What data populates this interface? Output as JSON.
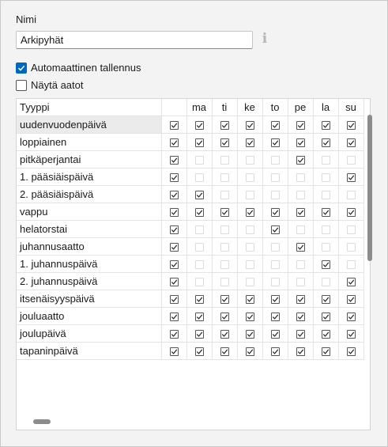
{
  "form": {
    "name_label": "Nimi",
    "name_value": "Arkipyhät",
    "info_icon": "i",
    "auto_save_label": "Automaattinen tallennus",
    "auto_save_checked": true,
    "show_eves_label": "Näytä aatot",
    "show_eves_checked": false
  },
  "grid": {
    "type_header": "Tyyppi",
    "day_headers": [
      "",
      "ma",
      "ti",
      "ke",
      "to",
      "pe",
      "la",
      "su"
    ],
    "rows": [
      {
        "name": "uudenvuodenpäivä",
        "checks": [
          1,
          1,
          1,
          1,
          1,
          1,
          1,
          1
        ],
        "selected": true
      },
      {
        "name": "loppiainen",
        "checks": [
          1,
          1,
          1,
          1,
          1,
          1,
          1,
          1
        ]
      },
      {
        "name": "pitkäperjantai",
        "checks": [
          1,
          0,
          0,
          0,
          0,
          1,
          0,
          0
        ]
      },
      {
        "name": "1. pääsiäispäivä",
        "checks": [
          1,
          0,
          0,
          0,
          0,
          0,
          0,
          1
        ]
      },
      {
        "name": "2. pääsiäispäivä",
        "checks": [
          1,
          1,
          0,
          0,
          0,
          0,
          0,
          0
        ]
      },
      {
        "name": "vappu",
        "checks": [
          1,
          1,
          1,
          1,
          1,
          1,
          1,
          1
        ]
      },
      {
        "name": "helatorstai",
        "checks": [
          1,
          0,
          0,
          0,
          1,
          0,
          0,
          0
        ]
      },
      {
        "name": "juhannusaatto",
        "checks": [
          1,
          0,
          0,
          0,
          0,
          1,
          0,
          0
        ]
      },
      {
        "name": "1. juhannuspäivä",
        "checks": [
          1,
          0,
          0,
          0,
          0,
          0,
          1,
          0
        ]
      },
      {
        "name": "2. juhannuspäivä",
        "checks": [
          1,
          0,
          0,
          0,
          0,
          0,
          0,
          1
        ]
      },
      {
        "name": "itsenäisyyspäivä",
        "checks": [
          1,
          1,
          1,
          1,
          1,
          1,
          1,
          1
        ]
      },
      {
        "name": "jouluaatto",
        "checks": [
          1,
          1,
          1,
          1,
          1,
          1,
          1,
          1
        ]
      },
      {
        "name": "joulupäivä",
        "checks": [
          1,
          1,
          1,
          1,
          1,
          1,
          1,
          1
        ]
      },
      {
        "name": "tapaninpäivä",
        "checks": [
          1,
          1,
          1,
          1,
          1,
          1,
          1,
          1
        ]
      }
    ]
  },
  "colors": {
    "accent": "#0067c0",
    "selected_row": "#ebebeb"
  }
}
